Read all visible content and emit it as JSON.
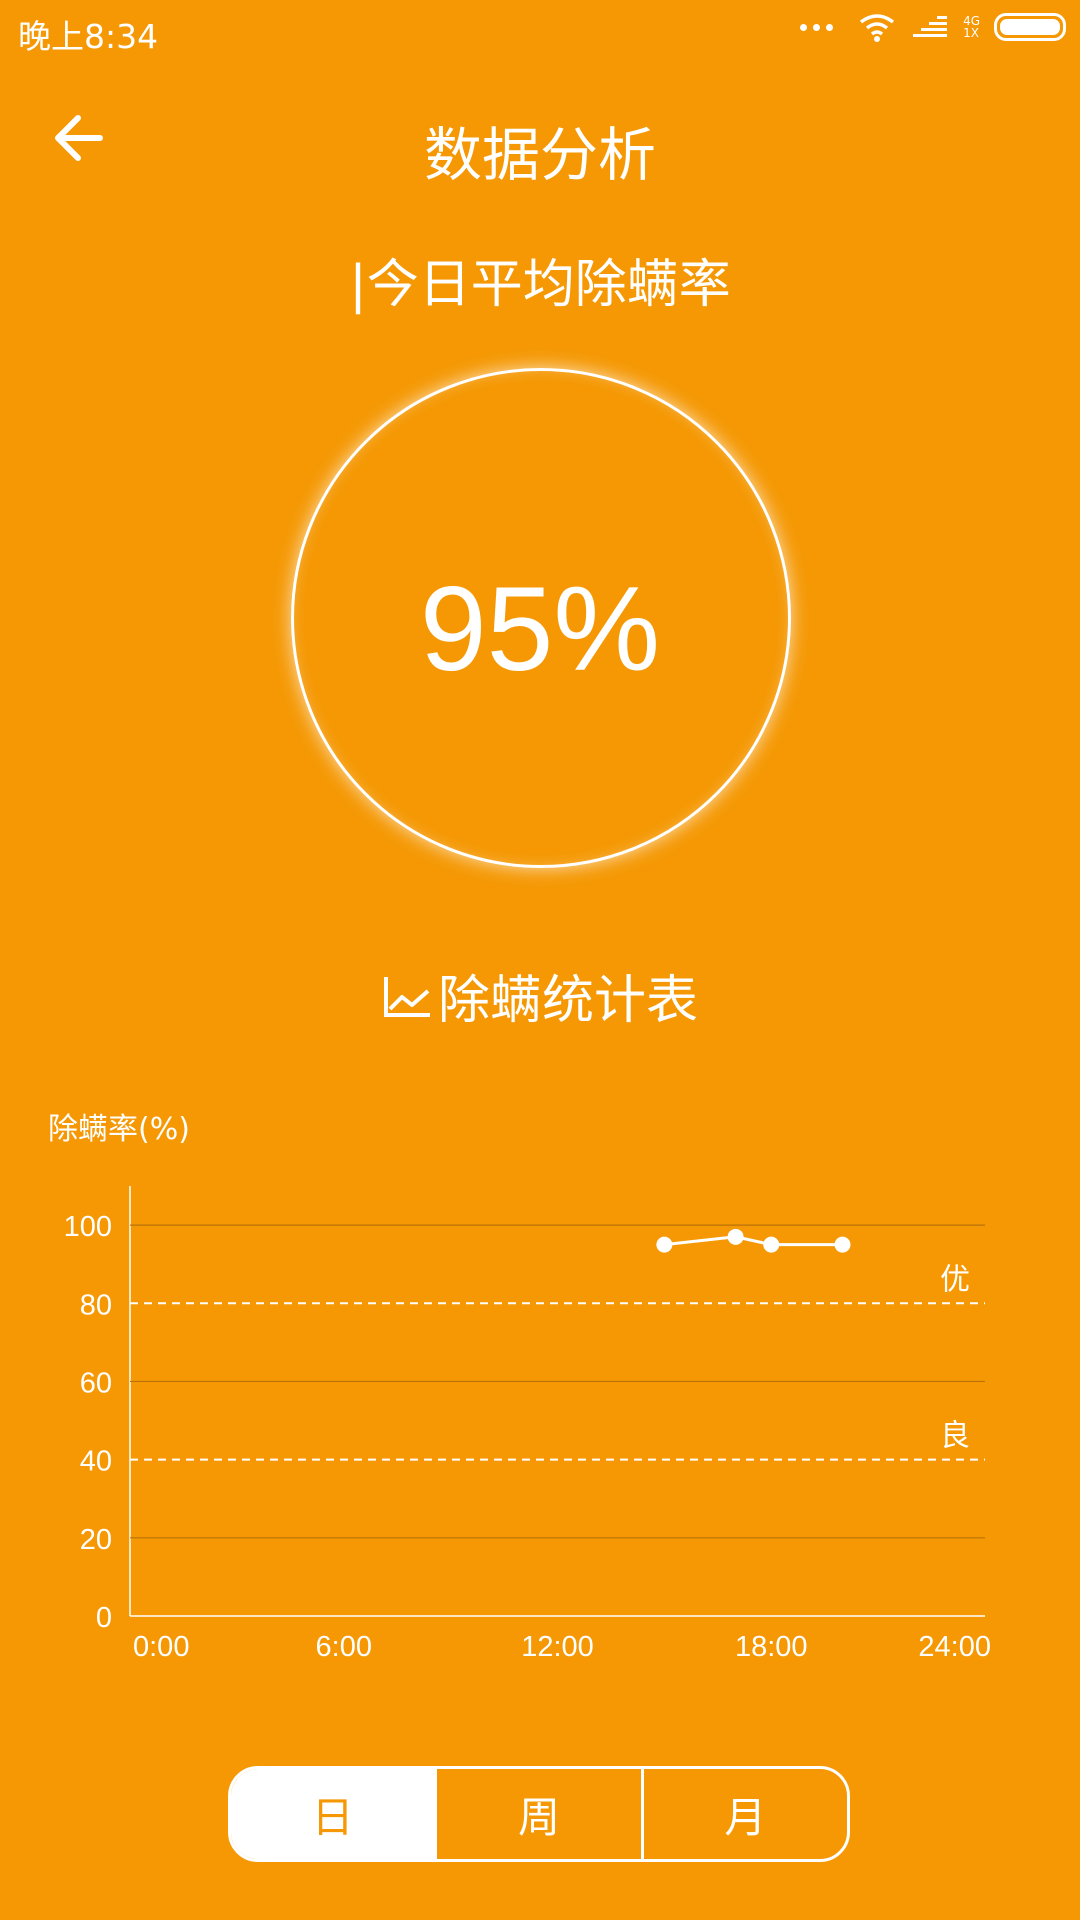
{
  "status_bar": {
    "time": "晚上8:34",
    "network": "4G",
    "sim": "1X"
  },
  "header": {
    "title": "数据分析"
  },
  "today": {
    "title": "|今日平均除螨率",
    "value": "95%"
  },
  "stats": {
    "title": "除螨统计表"
  },
  "chart_data": {
    "type": "line",
    "ylabel": "除螨率(%)",
    "xlabel": "",
    "ylim": [
      0,
      110
    ],
    "y_ticks": [
      0,
      20,
      40,
      60,
      80,
      100
    ],
    "x_tick_labels": [
      "0:00",
      "6:00",
      "12:00",
      "18:00",
      "24:00"
    ],
    "x_range_hours": [
      0,
      24
    ],
    "series": [
      {
        "x_hours": [
          15.0,
          17.0,
          18.0,
          20.0
        ],
        "y": [
          95,
          97,
          95,
          95
        ]
      }
    ],
    "thresholds": [
      {
        "label": "优",
        "value": 80
      },
      {
        "label": "良",
        "value": 40
      }
    ],
    "grid": true
  },
  "period_tabs": [
    {
      "label": "日",
      "active": true
    },
    {
      "label": "周",
      "active": false
    },
    {
      "label": "月",
      "active": false
    }
  ],
  "colors": {
    "background": "#F59804",
    "foreground": "#FFFFFF"
  }
}
